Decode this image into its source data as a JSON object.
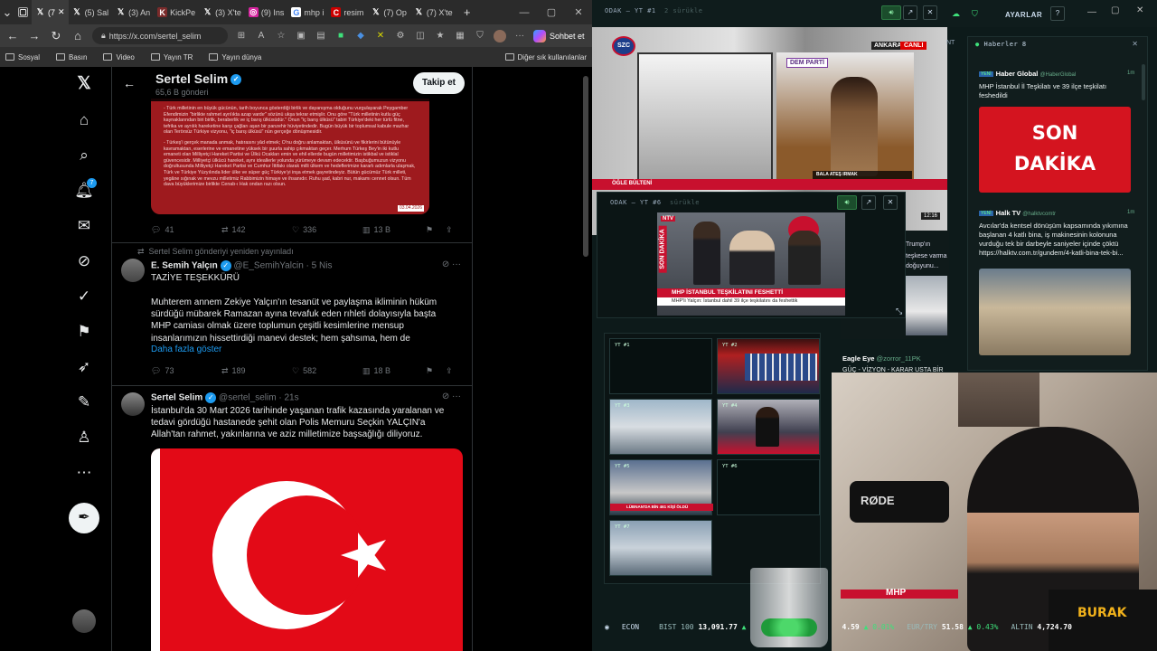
{
  "browser": {
    "tabs": [
      {
        "label": "",
        "icon": "tab-actions-icon"
      },
      {
        "label": "(7",
        "icon": "x-logo"
      },
      {
        "label": "(5) Sal",
        "icon": "x-logo"
      },
      {
        "label": "(3) An",
        "icon": "x-logo"
      },
      {
        "label": "KickPe",
        "icon": "kick-icon"
      },
      {
        "label": "(3) X'te",
        "icon": "x-logo"
      },
      {
        "label": "(9) Ins",
        "icon": "instagram-icon"
      },
      {
        "label": "mhp i",
        "icon": "google-icon"
      },
      {
        "label": "resim",
        "icon": "red-c-icon"
      },
      {
        "label": "(7) Op",
        "icon": "x-logo"
      },
      {
        "label": "(7) X'te",
        "icon": "x-logo"
      }
    ],
    "new_tab": "+",
    "url": "https://x.com/sertel_selim",
    "chat_label": "Sohbet et",
    "bookmarks": [
      "Sosyal",
      "Basın",
      "Video",
      "Yayın TR",
      "Yayın dünya"
    ],
    "other_bookmarks": "Diğer sık kullanılanlar"
  },
  "profile": {
    "name": "Sertel Selim",
    "posts": "65,6 B gönderi",
    "follow": "Takip et"
  },
  "image_post": {
    "paragraphs": [
      "- Türk milletinin en büyük gücünün, tarih boyunca gösterdiği birlik ve dayanışma olduğunu vurgulayarak Peygamber Efendimizin \"birlikte rahmet ayrılıkta azap vardır\" sözünü ukşa tekrar etmişlir. Onu göre \"Türk milletinin kutlu güç kaynaklarından biri birlik, beraberlik ve iç barış ülküsüdür.\" Onun \"iç barış ülküsü\" tabiri Türkiye'deki her türlü fitne, tefrika ve ayrılık hareketine karşı çağları aşan bir panzehir hüviyetindedir. Bugün büyük bir toplumsal kabule mazhar olan Terörsüz Türkiye vizyonu, \"iç barış ülküsü\" nün gerçeğe dönüşmesidir.",
      "- Türkeş'i gerçek manada anmak, hatırasını yâd etmek; O'nu doğru anlamaktan, ülküsünü ve fikirlerini bütünüyle kavramaktan, eserlerine ve emanetine yüksek bir şuurla sahip çıkmaktan geçer. Merhum Türkeş Bey'in iki kutlu emaneti olan Milliyetçi Hareket Partisi ve Ülkü Ocakları emin ve ehil ellerde bugün milletimizin istikbal ve istiklal güvencesidir. Milliyetçi ülkücü hareket, aynı ideallerle yolunda yürümeye devam edecektir. Başbuğumuzun vizyonu doğrultusunda Milliyetçi Hareket Partisi ve Cumhur İttifakı olarak milli ülkem ve hedeflerimize kararlı adımlarla ulaşmak, Türk ve Türkiye Yüzyılında lider ülke ve süper güç Türkiye'yi inşa etmek gayretindeyiz. Bütün gücümüz Türk milleti, yegâne sığınak ve mevzu milletimiz Rabbimizin himaye ve ihsanıdır. Ruhu şad, kabri nur, makamı cennet olsun. Tüm dava büyüklerimize birlikte Cenab-ı Hak ondan razı olsun."
    ],
    "date": "03.04.2026",
    "replies": "41",
    "reposts": "142",
    "likes": "336",
    "views": "13 B"
  },
  "retweet_note": "Sertel Selim gönderiyi yeniden yayınladı",
  "tweet2": {
    "name": "E. Semih Yalçın",
    "handle": "@E_SemihYalcin",
    "time": "· 5 Nis",
    "title": "TAZİYE TEŞEKKÜRÜ",
    "text": "Muhterem annem Zekiye Yalçın'ın tesanüt ve paylaşma ikliminin hüküm sürdüğü mübarek Ramazan ayına tevafuk eden rıhleti dolayısıyla başta MHP camiası olmak üzere toplumun çeşitli kesimlerine mensup insanlarımızın hissettirdiği manevi destek; hem şahsıma, hem de",
    "more": "Daha fazla göster",
    "replies": "73",
    "reposts": "189",
    "likes": "582",
    "views": "18 B"
  },
  "tweet3": {
    "name": "Sertel Selim",
    "handle": "@sertel_selim",
    "time": "· 21s",
    "text": "İstanbul'da 30 Mart 2026 tarihinde yaşanan trafik kazasında yaralanan ve tedavi gördüğü hastanede şehit olan Polis Memuru Seçkin YALÇIN'a Allah'tan rahmet, yakınlarına ve aziz milletimize başsağlığı diliyoruz."
  },
  "x_nav": {
    "notification_count": "7",
    "icons": [
      "x-logo-icon",
      "home-icon",
      "search-icon",
      "bell-icon",
      "messages-icon",
      "grok-icon",
      "verified-icon",
      "bookmark-icon",
      "rocket-icon",
      "edit-icon",
      "profile-icon",
      "more-icon"
    ]
  },
  "dashboard": {
    "settings": "AYARLAR",
    "help": "?",
    "main_panel_title": "ODAK — YT #1",
    "main_panel_sub": "2 sürükle",
    "main_channel": "SZC",
    "main_location": "ANKARA",
    "main_live": "CANLI",
    "main_sign": "DEM PARTİ",
    "main_reporter": "BALA ATEŞ IRMAK",
    "main_reporter_role": "MUHABİR / ANKARA",
    "main_bulletin": "ÖĞLE BÜLTENİ",
    "main_clock": "12:16",
    "popup_title": "ODAK — YT #6",
    "popup_sub": "sürükle",
    "popup_channel": "NTV",
    "popup_breaking": "SON DAKİKA",
    "popup_headline": "MHP İSTANBUL TEŞKİLATINI FESHETTİ",
    "popup_subline": "MHP'li Yalçın: İstanbul dahil 39 ilçe teşkilatını da feshettik",
    "grid_labels": [
      "YT #1",
      "YT #2",
      "YT #3",
      "YT #4",
      "YT #5",
      "YT #6",
      "YT #7"
    ],
    "grid_caption": "LÜBNAN'DA BİN 461 KİŞİ ÖLDÜ",
    "news_title": "Haberler",
    "news_count": "8",
    "news_items": [
      {
        "badge": "YENİ",
        "source": "Haber Global",
        "handle": "@HaberGlobal",
        "age": "1m",
        "text": "MHP İstanbul İl Teşkilatı ve 39 ilçe teşkilatı feshedildi"
      },
      {
        "badge": "YENİ",
        "source": "Halk TV",
        "handle": "@halktvcomtr",
        "age": "1m",
        "text": "Avcılar'da kentsel dönüşüm kapsamında yıkımına başlanan 4 katlı bina, iş makinesinin kolonuna vurduğu tek bir darbeyle saniyeler içinde çöktü https://halktv.com.tr/gundem/4-katli-bina-tek-bi..."
      }
    ],
    "son_dakika": "SON DAKİKA",
    "mid_news_text1": "Trump'ın",
    "mid_news_text2": "teşkese varma",
    "mid_news_text3": "doğuyunu...",
    "mid_news_source": "Eagle Eye",
    "mid_news_handle": "@zorror_11PK",
    "mid_news_text": "GÜÇ - VİZYON - KARAR USTA BİR",
    "mid_news_tag": "NT",
    "mhp_label": "MHP",
    "ticker": [
      {
        "label": "ECON",
        "value": "",
        "change": ""
      },
      {
        "label": "BIST 100",
        "value": "13,091.77",
        "change": "▲"
      },
      {
        "label": "",
        "value": "4.59",
        "change": "▲ 0.01%"
      },
      {
        "label": "EUR/TRY",
        "value": "51.58",
        "change": "▲ 0.43%"
      },
      {
        "label": "ALTIN",
        "value": "4,724.70",
        "change": ""
      }
    ],
    "streamer_name": "BURAK",
    "mic_brand": "RØDE"
  },
  "colors": {
    "x_blue": "#1d9bf0",
    "flag_red": "#e30a17",
    "accent_green": "#3ee07a",
    "streamer_gold": "#f2b21b"
  }
}
